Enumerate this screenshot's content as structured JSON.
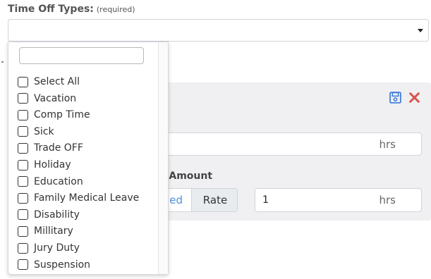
{
  "field": {
    "label": "Time Off Types:",
    "required_note": "(required)",
    "selected_value": ""
  },
  "dropdown": {
    "search_value": "",
    "options": [
      "Select All",
      "Vacation",
      "Comp Time",
      "Sick",
      "Trade OFF",
      "Holiday",
      "Education",
      "Family Medical Leave",
      "Disability",
      "Millitary",
      "Jury Duty",
      "Suspension"
    ]
  },
  "panel": {
    "hours_unit_1": "hrs",
    "section_label": "cted Amount",
    "toggle": {
      "fixed_label": "ed",
      "rate_label": "Rate"
    },
    "amount": {
      "value": "1",
      "unit": "hrs"
    }
  },
  "colors": {
    "accent_blue": "#4a90e2",
    "delete_red": "#d9534f",
    "panel_bg": "#f0f0f2"
  },
  "icons": {
    "save": "save-icon",
    "delete": "close-icon",
    "caret": "caret-down-icon"
  }
}
